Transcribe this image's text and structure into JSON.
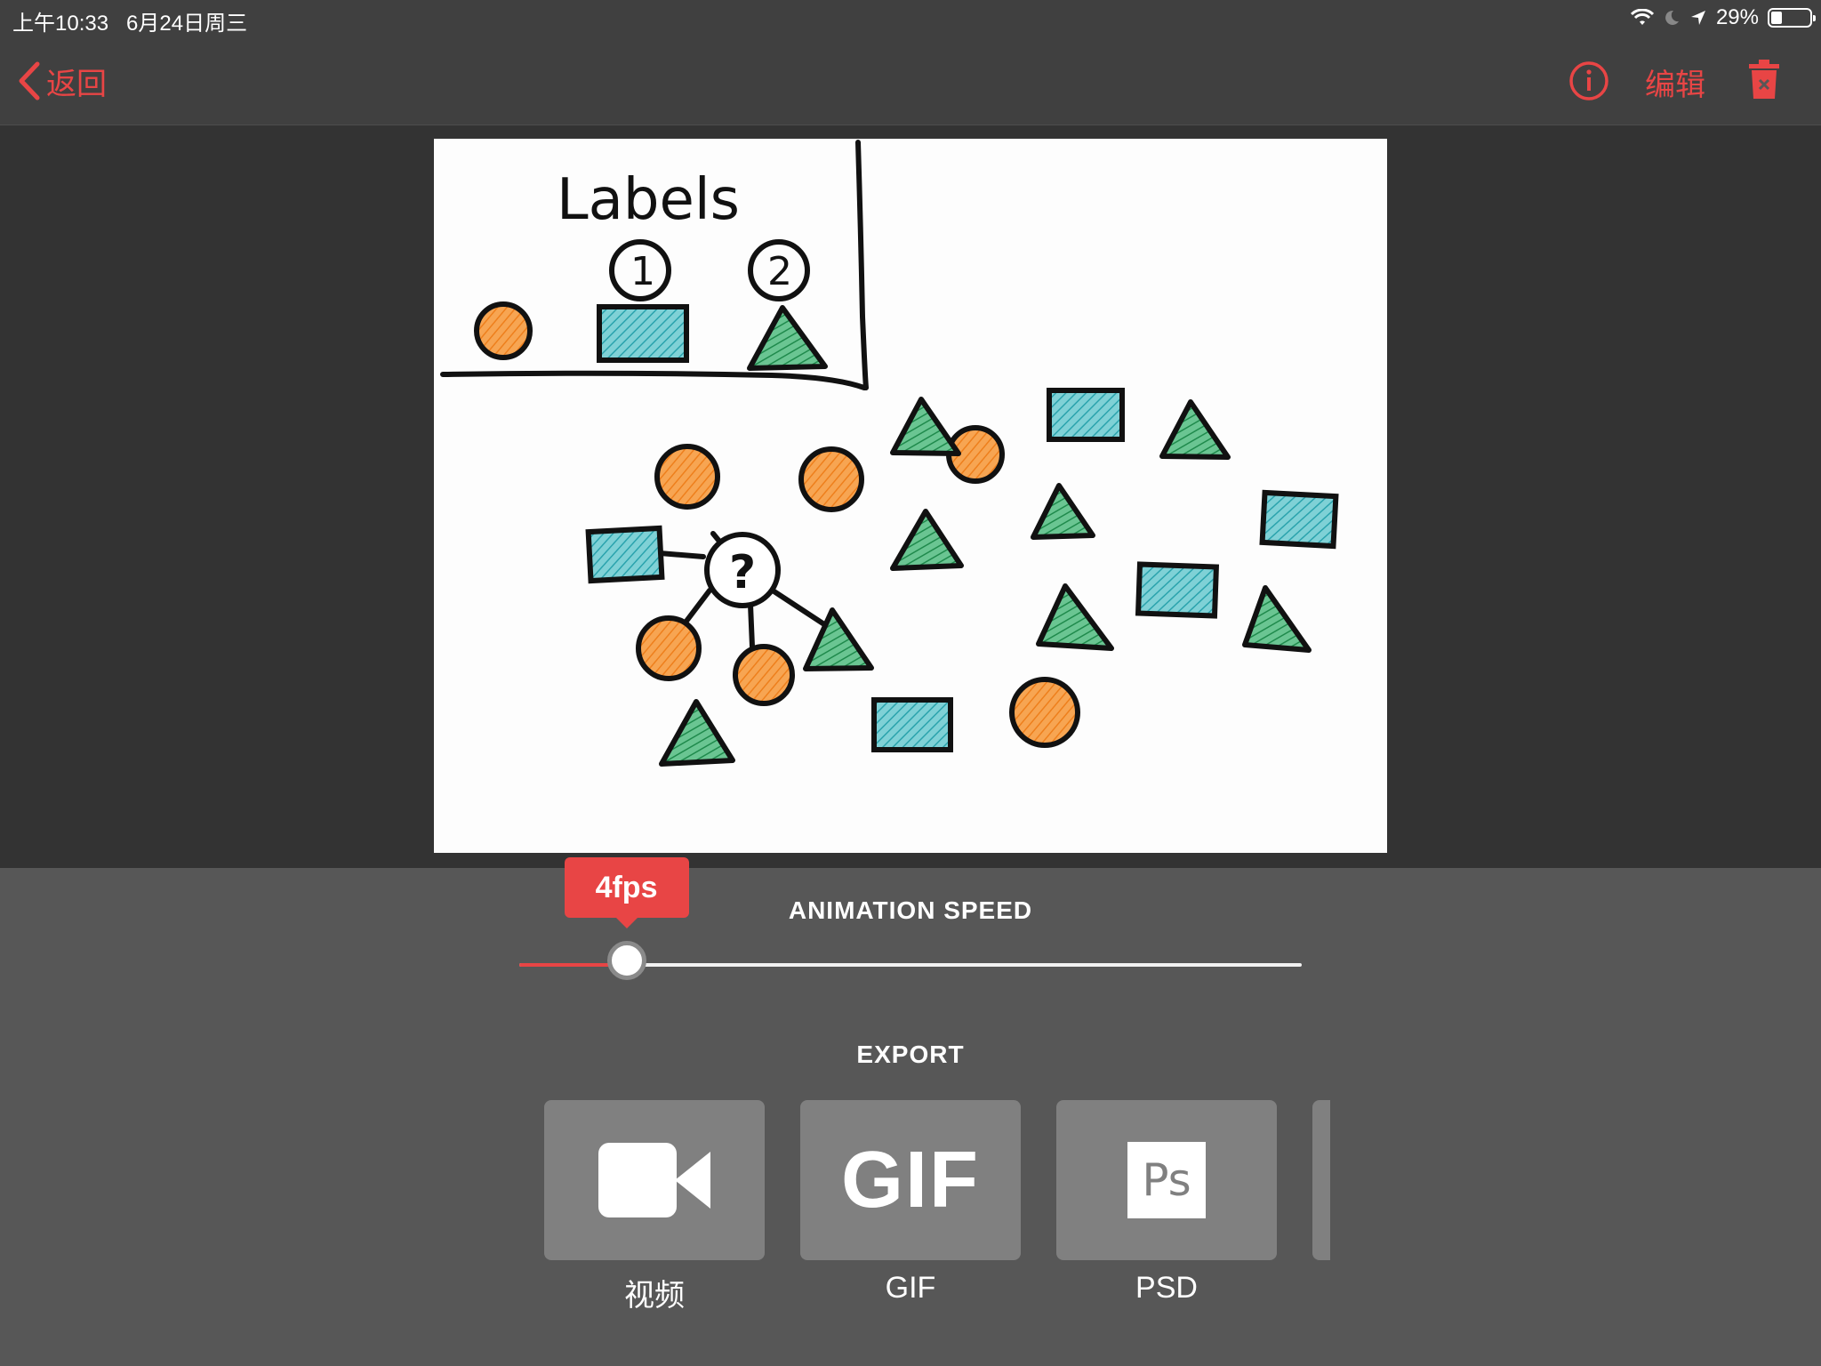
{
  "status_bar": {
    "time_date": "上午10:33   6月24日周三",
    "battery": "29%",
    "battery_level": 0.29
  },
  "nav": {
    "back_label": "返回",
    "edit_label": "编辑"
  },
  "drawing": {
    "title": "Labels",
    "label_1": "1",
    "label_2": "2",
    "unknown": "?"
  },
  "speed": {
    "title": "ANIMATION SPEED",
    "value_label": "4fps",
    "slider_fraction": 0.137
  },
  "export": {
    "title": "EXPORT",
    "items": [
      {
        "label": "视频",
        "icon": "video-camera-icon"
      },
      {
        "label": "GIF",
        "tile_text": "GIF"
      },
      {
        "label": "PSD",
        "tile_text": "Ps"
      }
    ]
  },
  "colors": {
    "accent": "#e84545",
    "orange": "#f28c28",
    "teal": "#4bb8c0",
    "green": "#2e9e5b"
  }
}
